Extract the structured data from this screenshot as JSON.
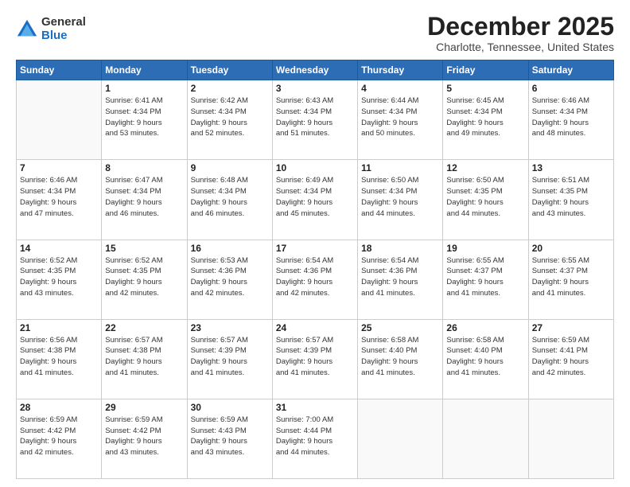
{
  "logo": {
    "general": "General",
    "blue": "Blue"
  },
  "header": {
    "month": "December 2025",
    "location": "Charlotte, Tennessee, United States"
  },
  "weekdays": [
    "Sunday",
    "Monday",
    "Tuesday",
    "Wednesday",
    "Thursday",
    "Friday",
    "Saturday"
  ],
  "weeks": [
    [
      {
        "day": "",
        "info": ""
      },
      {
        "day": "1",
        "info": "Sunrise: 6:41 AM\nSunset: 4:34 PM\nDaylight: 9 hours\nand 53 minutes."
      },
      {
        "day": "2",
        "info": "Sunrise: 6:42 AM\nSunset: 4:34 PM\nDaylight: 9 hours\nand 52 minutes."
      },
      {
        "day": "3",
        "info": "Sunrise: 6:43 AM\nSunset: 4:34 PM\nDaylight: 9 hours\nand 51 minutes."
      },
      {
        "day": "4",
        "info": "Sunrise: 6:44 AM\nSunset: 4:34 PM\nDaylight: 9 hours\nand 50 minutes."
      },
      {
        "day": "5",
        "info": "Sunrise: 6:45 AM\nSunset: 4:34 PM\nDaylight: 9 hours\nand 49 minutes."
      },
      {
        "day": "6",
        "info": "Sunrise: 6:46 AM\nSunset: 4:34 PM\nDaylight: 9 hours\nand 48 minutes."
      }
    ],
    [
      {
        "day": "7",
        "info": "Sunrise: 6:46 AM\nSunset: 4:34 PM\nDaylight: 9 hours\nand 47 minutes."
      },
      {
        "day": "8",
        "info": "Sunrise: 6:47 AM\nSunset: 4:34 PM\nDaylight: 9 hours\nand 46 minutes."
      },
      {
        "day": "9",
        "info": "Sunrise: 6:48 AM\nSunset: 4:34 PM\nDaylight: 9 hours\nand 46 minutes."
      },
      {
        "day": "10",
        "info": "Sunrise: 6:49 AM\nSunset: 4:34 PM\nDaylight: 9 hours\nand 45 minutes."
      },
      {
        "day": "11",
        "info": "Sunrise: 6:50 AM\nSunset: 4:34 PM\nDaylight: 9 hours\nand 44 minutes."
      },
      {
        "day": "12",
        "info": "Sunrise: 6:50 AM\nSunset: 4:35 PM\nDaylight: 9 hours\nand 44 minutes."
      },
      {
        "day": "13",
        "info": "Sunrise: 6:51 AM\nSunset: 4:35 PM\nDaylight: 9 hours\nand 43 minutes."
      }
    ],
    [
      {
        "day": "14",
        "info": "Sunrise: 6:52 AM\nSunset: 4:35 PM\nDaylight: 9 hours\nand 43 minutes."
      },
      {
        "day": "15",
        "info": "Sunrise: 6:52 AM\nSunset: 4:35 PM\nDaylight: 9 hours\nand 42 minutes."
      },
      {
        "day": "16",
        "info": "Sunrise: 6:53 AM\nSunset: 4:36 PM\nDaylight: 9 hours\nand 42 minutes."
      },
      {
        "day": "17",
        "info": "Sunrise: 6:54 AM\nSunset: 4:36 PM\nDaylight: 9 hours\nand 42 minutes."
      },
      {
        "day": "18",
        "info": "Sunrise: 6:54 AM\nSunset: 4:36 PM\nDaylight: 9 hours\nand 41 minutes."
      },
      {
        "day": "19",
        "info": "Sunrise: 6:55 AM\nSunset: 4:37 PM\nDaylight: 9 hours\nand 41 minutes."
      },
      {
        "day": "20",
        "info": "Sunrise: 6:55 AM\nSunset: 4:37 PM\nDaylight: 9 hours\nand 41 minutes."
      }
    ],
    [
      {
        "day": "21",
        "info": "Sunrise: 6:56 AM\nSunset: 4:38 PM\nDaylight: 9 hours\nand 41 minutes."
      },
      {
        "day": "22",
        "info": "Sunrise: 6:57 AM\nSunset: 4:38 PM\nDaylight: 9 hours\nand 41 minutes."
      },
      {
        "day": "23",
        "info": "Sunrise: 6:57 AM\nSunset: 4:39 PM\nDaylight: 9 hours\nand 41 minutes."
      },
      {
        "day": "24",
        "info": "Sunrise: 6:57 AM\nSunset: 4:39 PM\nDaylight: 9 hours\nand 41 minutes."
      },
      {
        "day": "25",
        "info": "Sunrise: 6:58 AM\nSunset: 4:40 PM\nDaylight: 9 hours\nand 41 minutes."
      },
      {
        "day": "26",
        "info": "Sunrise: 6:58 AM\nSunset: 4:40 PM\nDaylight: 9 hours\nand 41 minutes."
      },
      {
        "day": "27",
        "info": "Sunrise: 6:59 AM\nSunset: 4:41 PM\nDaylight: 9 hours\nand 42 minutes."
      }
    ],
    [
      {
        "day": "28",
        "info": "Sunrise: 6:59 AM\nSunset: 4:42 PM\nDaylight: 9 hours\nand 42 minutes."
      },
      {
        "day": "29",
        "info": "Sunrise: 6:59 AM\nSunset: 4:42 PM\nDaylight: 9 hours\nand 43 minutes."
      },
      {
        "day": "30",
        "info": "Sunrise: 6:59 AM\nSunset: 4:43 PM\nDaylight: 9 hours\nand 43 minutes."
      },
      {
        "day": "31",
        "info": "Sunrise: 7:00 AM\nSunset: 4:44 PM\nDaylight: 9 hours\nand 44 minutes."
      },
      {
        "day": "",
        "info": ""
      },
      {
        "day": "",
        "info": ""
      },
      {
        "day": "",
        "info": ""
      }
    ]
  ]
}
